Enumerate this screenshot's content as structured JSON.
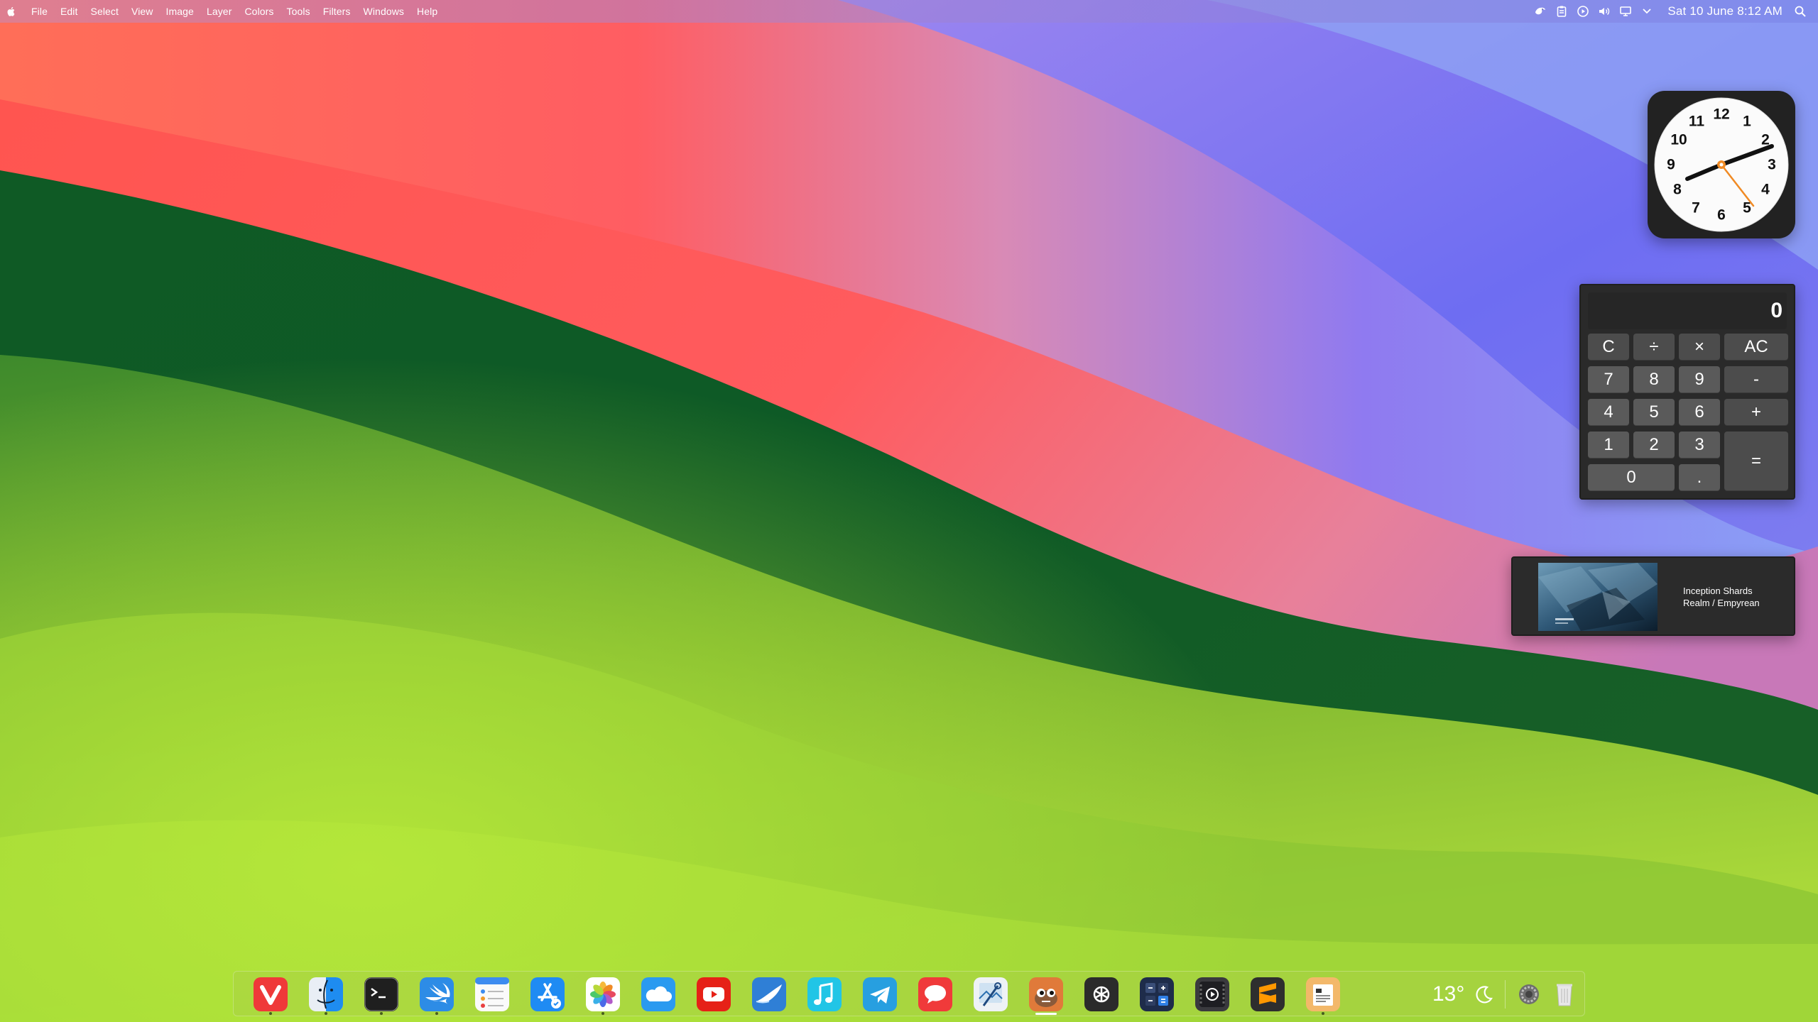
{
  "menubar": {
    "apple_icon": "apple-logo-icon",
    "menus": [
      "File",
      "Edit",
      "Select",
      "View",
      "Image",
      "Layer",
      "Colors",
      "Tools",
      "Filters",
      "Windows",
      "Help"
    ],
    "status_icons": [
      "gimp-icon",
      "clipboard-icon",
      "play-circle-icon",
      "volume-icon",
      "display-icon",
      "chevron-down-icon"
    ],
    "datetime": "Sat 10 June  8:12 AM",
    "search_icon": "search-icon"
  },
  "clock_widget": {
    "numbers": [
      "12",
      "1",
      "2",
      "3",
      "4",
      "5",
      "6",
      "7",
      "8",
      "9",
      "10",
      "11"
    ],
    "time": "8:12",
    "second_hand_accent": "#f08a24"
  },
  "calculator": {
    "display": "0",
    "keys": {
      "c": "C",
      "divide": "÷",
      "multiply": "×",
      "ac": "AC",
      "seven": "7",
      "eight": "8",
      "nine": "9",
      "minus": "-",
      "four": "4",
      "five": "5",
      "six": "6",
      "plus": "+",
      "one": "1",
      "two": "2",
      "three": "3",
      "equals": "=",
      "zero": "0",
      "dot": "."
    }
  },
  "now_playing": {
    "title": "Inception Shards",
    "subtitle": "Realm / Empyrean"
  },
  "dock": {
    "apps": [
      "vivaldi-icon",
      "finder-icon",
      "terminal-icon",
      "swift-icon",
      "reminders-icon",
      "app-store-icon",
      "photos-icon",
      "icloud-icon",
      "youtube-icon",
      "wing-icon",
      "music-icon",
      "telegram-icon",
      "speech-bubble-icon",
      "preview-icon",
      "gimp-icon",
      "chatgpt-icon",
      "calculator-icon",
      "video-player-icon",
      "sublime-text-icon",
      "archive-utility-icon"
    ],
    "weather_temp": "13°",
    "weather_icon": "moon-icon",
    "extra_icons": [
      "settings-icon",
      "trash-icon"
    ]
  },
  "colors": {
    "wallpaper_green": "#1f6b2a",
    "wallpaper_lime": "#a7d838",
    "wallpaper_red": "#ff5a5a",
    "wallpaper_blue": "#7a7af5",
    "widget_dark": "#2a2a2a"
  }
}
